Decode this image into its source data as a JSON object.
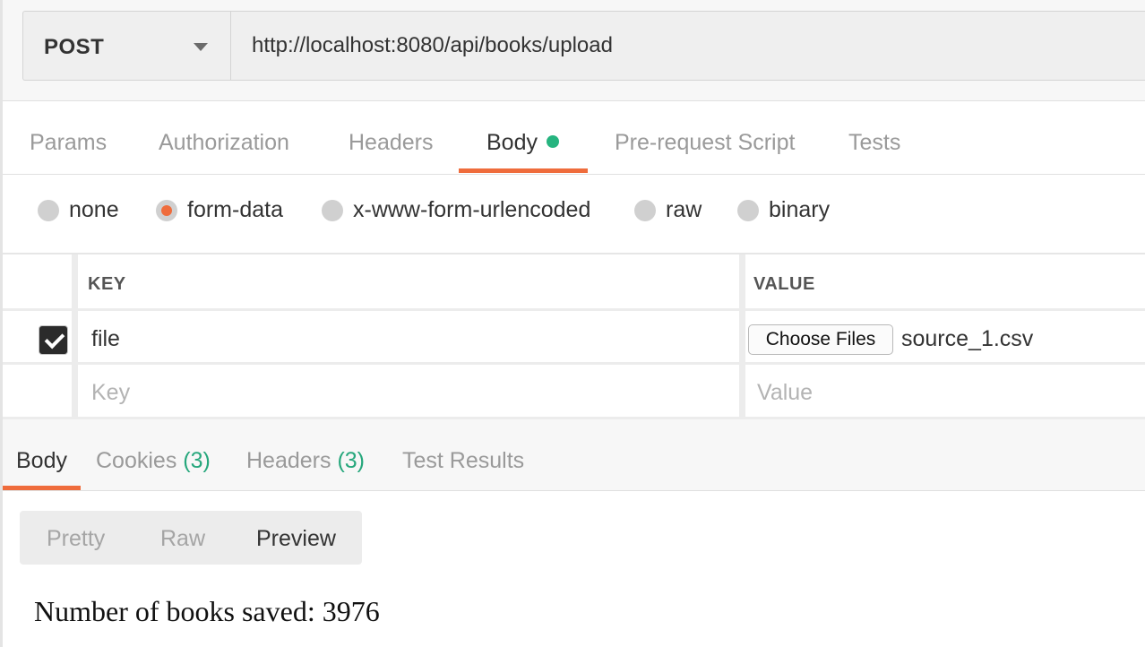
{
  "request": {
    "method": "POST",
    "url": "http://localhost:8080/api/books/upload"
  },
  "request_tabs": [
    {
      "label": "Params",
      "active": false
    },
    {
      "label": "Authorization",
      "active": false
    },
    {
      "label": "Headers",
      "active": false
    },
    {
      "label": "Body",
      "active": true,
      "indicator": "green-dot"
    },
    {
      "label": "Pre-request Script",
      "active": false
    },
    {
      "label": "Tests",
      "active": false
    }
  ],
  "body_types": [
    {
      "label": "none",
      "selected": false
    },
    {
      "label": "form-data",
      "selected": true
    },
    {
      "label": "x-www-form-urlencoded",
      "selected": false
    },
    {
      "label": "raw",
      "selected": false
    },
    {
      "label": "binary",
      "selected": false
    }
  ],
  "form_table": {
    "headers": {
      "key": "KEY",
      "value": "VALUE"
    },
    "rows": [
      {
        "checked": true,
        "key": "file",
        "button": "Choose Files",
        "file_name": "source_1.csv"
      }
    ],
    "new_row": {
      "key_placeholder": "Key",
      "value_placeholder": "Value"
    }
  },
  "response_tabs": [
    {
      "label": "Body",
      "active": true
    },
    {
      "label": "Cookies",
      "count": "(3)"
    },
    {
      "label": "Headers",
      "count": "(3)"
    },
    {
      "label": "Test Results"
    }
  ],
  "view_modes": [
    {
      "label": "Pretty",
      "active": false
    },
    {
      "label": "Raw",
      "active": false
    },
    {
      "label": "Preview",
      "active": true
    }
  ],
  "response_preview": "Number of books saved: 3976",
  "colors": {
    "accent": "#ef6c3c",
    "status_green": "#26b47f",
    "count_green": "#26a77c"
  }
}
